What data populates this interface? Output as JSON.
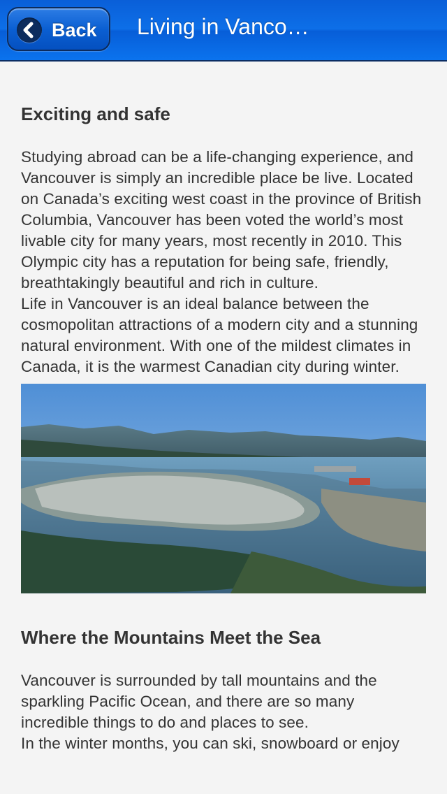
{
  "navbar": {
    "back_label": "Back",
    "title": "Living in Vanco…"
  },
  "sections": [
    {
      "heading": "Exciting and safe",
      "paragraphs": [
        "Studying abroad can be a life-changing experience, and Vancouver is simply an incredible place be live. Located on Canada’s exciting west coast in the province of British Columbia, Vancouver has been voted the world’s most livable city for many years, most recently in 2010. This Olympic city has a reputation for being safe, friendly, breathtakingly beautiful and rich in culture.",
        "Life in Vancouver is an ideal balance between the cosmopolitan attractions of a modern city and a stunning natural environment. With one of the mildest climates in Canada, it is the warmest Canadian city during winter."
      ]
    },
    {
      "heading": "Where the Mountains Meet the Sea",
      "paragraphs": [
        "Vancouver is surrounded by tall mountains and the sparkling Pacific Ocean, and there are so many incredible things to do and places to see.",
        "In the winter months, you can ski, snowboard or enjoy"
      ]
    }
  ],
  "colors": {
    "navbar_blue": "#0d6fe8",
    "text": "#333333",
    "background": "#f4f4f4"
  },
  "icons": {
    "back": "chevron-left-icon"
  }
}
